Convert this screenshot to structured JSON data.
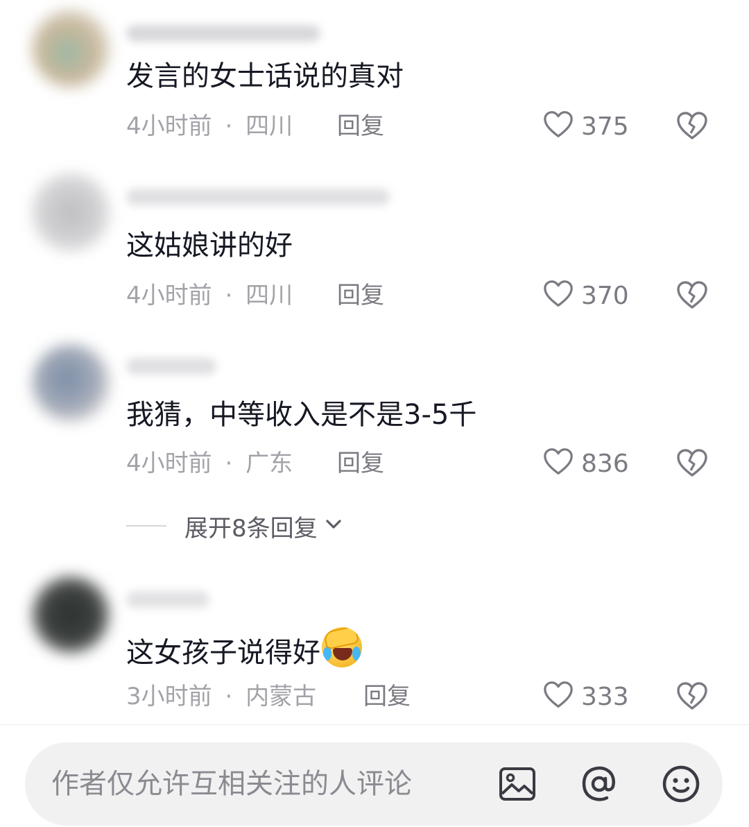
{
  "comments": [
    {
      "text": "发言的女士话说的真对",
      "time": "4小时前",
      "separator": "·",
      "location": "四川",
      "reply_label": "回复",
      "likes": "375"
    },
    {
      "text": "这姑娘讲的好",
      "time": "4小时前",
      "separator": "·",
      "location": "四川",
      "reply_label": "回复",
      "likes": "370"
    },
    {
      "text": "我猜，中等收入是不是3-5千",
      "time": "4小时前",
      "separator": "·",
      "location": "广东",
      "reply_label": "回复",
      "likes": "836",
      "expand_replies_label": "展开8条回复"
    },
    {
      "text": "这女孩子说得好",
      "emoji": "face-palm-crying-emoji",
      "time": "3小时前",
      "separator": "·",
      "location": "内蒙古",
      "reply_label": "回复",
      "likes": "333"
    }
  ],
  "input": {
    "placeholder": "作者仅允许互相关注的人评论",
    "icons": [
      "image-icon",
      "at-mention-icon",
      "emoji-icon"
    ]
  },
  "colors": {
    "text_primary": "#161823",
    "text_secondary": "#a2a3a8",
    "reply": "#7a7b82",
    "input_bg": "#f1f1f2",
    "icon": "#3a3b42"
  }
}
